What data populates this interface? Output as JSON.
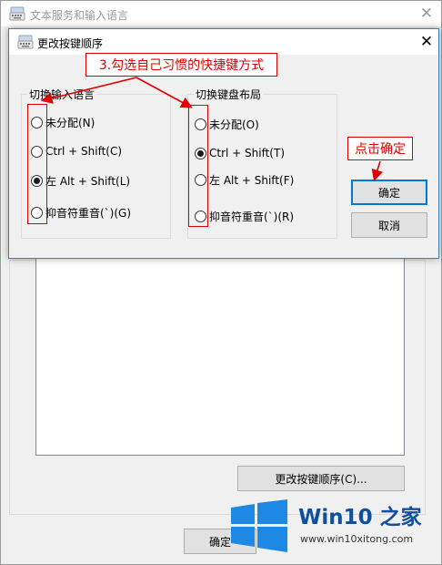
{
  "background_window": {
    "title": "文本服务和输入语言",
    "change_sequence_button": "更改按键顺序(C)...",
    "ok_button_partial": "确定"
  },
  "dialog": {
    "title": "更改按键顺序",
    "close_glyph": "✕",
    "input_language_group": {
      "label": "切换输入语言",
      "options": [
        {
          "label": "未分配(N)",
          "checked": false
        },
        {
          "label": "Ctrl + Shift(C)",
          "checked": false
        },
        {
          "label": "左 Alt + Shift(L)",
          "checked": true
        },
        {
          "label": "抑音符重音(`)(G)",
          "checked": false
        }
      ]
    },
    "keyboard_layout_group": {
      "label": "切换键盘布局",
      "options": [
        {
          "label": "未分配(O)",
          "checked": false
        },
        {
          "label": "Ctrl + Shift(T)",
          "checked": true
        },
        {
          "label": "左 Alt + Shift(F)",
          "checked": false
        },
        {
          "label": "抑音符重音(`)(R)",
          "checked": false
        }
      ]
    },
    "ok_button": "确定",
    "cancel_button": "取消"
  },
  "annotations": {
    "step3": "3.勾选自己习惯的快捷键方式",
    "click_ok": "点击确定",
    "color": "#e00000"
  },
  "watermark": {
    "brand": "Win10 之家",
    "url": "www.win10xitong.com",
    "logo_color": "#1e88e5"
  },
  "icons": {
    "window_icon": "keyboard-icon",
    "close": "close-icon"
  }
}
